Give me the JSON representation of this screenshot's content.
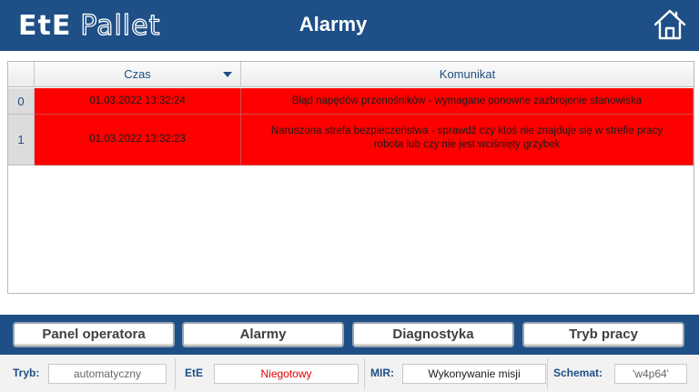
{
  "header": {
    "logo_main": "EtE",
    "logo_sub": "Pallet",
    "title": "Alarmy",
    "home_icon": "home-icon"
  },
  "table": {
    "columns": [
      "",
      "Czas",
      "Komunikat"
    ],
    "sort_icon": "sort-desc-icon",
    "rows": [
      {
        "index": "0",
        "time": "01.03.2022 13:32:24",
        "message": "Błąd napędów przenośników - wymagane ponowne zazbrojenie stanowiska"
      },
      {
        "index": "1",
        "time": "01.03.2022 13:32:23",
        "message": "Naruszona strefa bezpieczeństwa - sprawdź czy ktoś nie znajduje się w strefie pracy robota lub czy nie jest wciśnięty grzybek"
      }
    ],
    "alarm_color": "#ff0000"
  },
  "nav": {
    "buttons": [
      "Panel operatora",
      "Alarmy",
      "Diagnostyka",
      "Tryb pracy"
    ]
  },
  "status": {
    "tryb_label": "Tryb:",
    "tryb_value": "automatyczny",
    "ete_label": "EtE",
    "ete_value": "Niegotowy",
    "mir_label": "MIR:",
    "mir_value": "Wykonywanie misji",
    "schemat_label": "Schemat:",
    "schemat_value": "'w4p64'"
  },
  "colors": {
    "brand_blue": "#1e4f86",
    "error_red": "#e00000"
  }
}
